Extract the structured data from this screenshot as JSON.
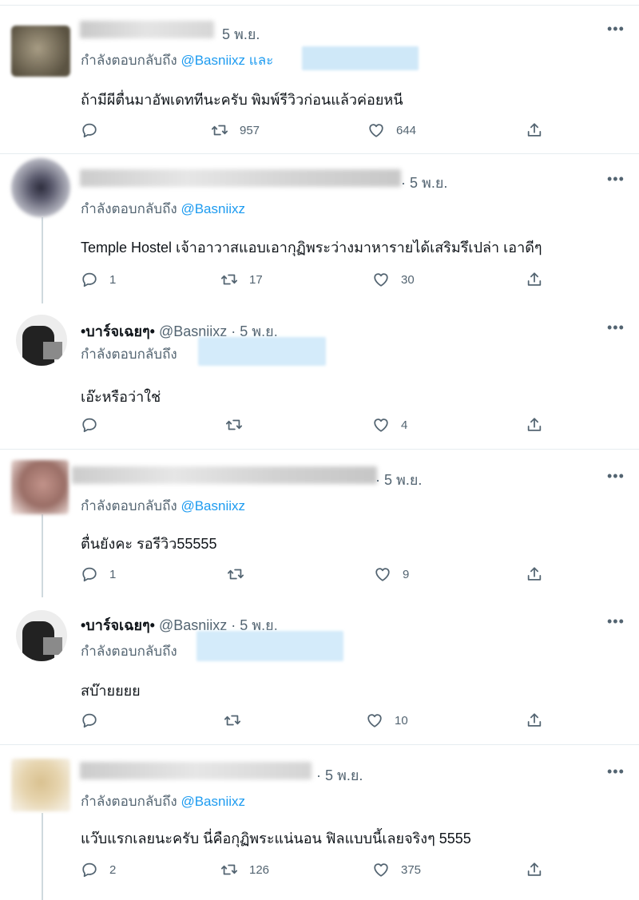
{
  "more_label": "•••",
  "tweets": [
    {
      "time": "5 พ.ย.",
      "reply_prefix": "กำลังตอบกลับถึง",
      "mention": "@Basniixz",
      "mention_suffix": "และ",
      "text": "ถ้ามีผีตื่นมาอัพเดททีนะครับ พิมพ์รีวิวก่อนแล้วค่อยหนี",
      "replies": "",
      "retweets": "957",
      "likes": "644"
    },
    {
      "time": "· 5 พ.ย.",
      "reply_prefix": "กำลังตอบกลับถึง",
      "mention": "@Basniixz",
      "text": "Temple Hostel เจ้าอาวาสแอบเอากุฏิพระว่างมาหารายได้เสริมรึเปล่า เอาดีๆ",
      "replies": "1",
      "retweets": "17",
      "likes": "30"
    },
    {
      "name": "•บาร์จเฉยๆ•",
      "handle": "@Basniixz · 5 พ.ย.",
      "reply_prefix": "กำลังตอบกลับถึง",
      "text": "เอ๊ะหรือว่าใช่",
      "replies": "",
      "retweets": "",
      "likes": "4"
    },
    {
      "time": "· 5 พ.ย.",
      "reply_prefix": "กำลังตอบกลับถึง",
      "mention": "@Basniixz",
      "text": "ตื่นยังคะ รอรีวิว55555",
      "replies": "1",
      "retweets": "",
      "likes": "9"
    },
    {
      "name": "•บาร์จเฉยๆ•",
      "handle": "@Basniixz · 5 พ.ย.",
      "reply_prefix": "กำลังตอบกลับถึง",
      "text": "สบ๊ายยยย",
      "replies": "",
      "retweets": "",
      "likes": "10"
    },
    {
      "time": "· 5 พ.ย.",
      "reply_prefix": "กำลังตอบกลับถึง",
      "mention": "@Basniixz",
      "text": "แว๊บแรกเลยนะครับ นี่คือกุฏิพระแน่นอน ฟิลแบบนี้เลยจริงๆ 5555",
      "replies": "2",
      "retweets": "126",
      "likes": "375"
    }
  ],
  "colors": {
    "mention": "#1d9bf0",
    "muted": "#536471",
    "separator": "#e6ecf0"
  },
  "icons": [
    "reply-icon",
    "retweet-icon",
    "like-icon",
    "share-icon",
    "more-icon"
  ]
}
